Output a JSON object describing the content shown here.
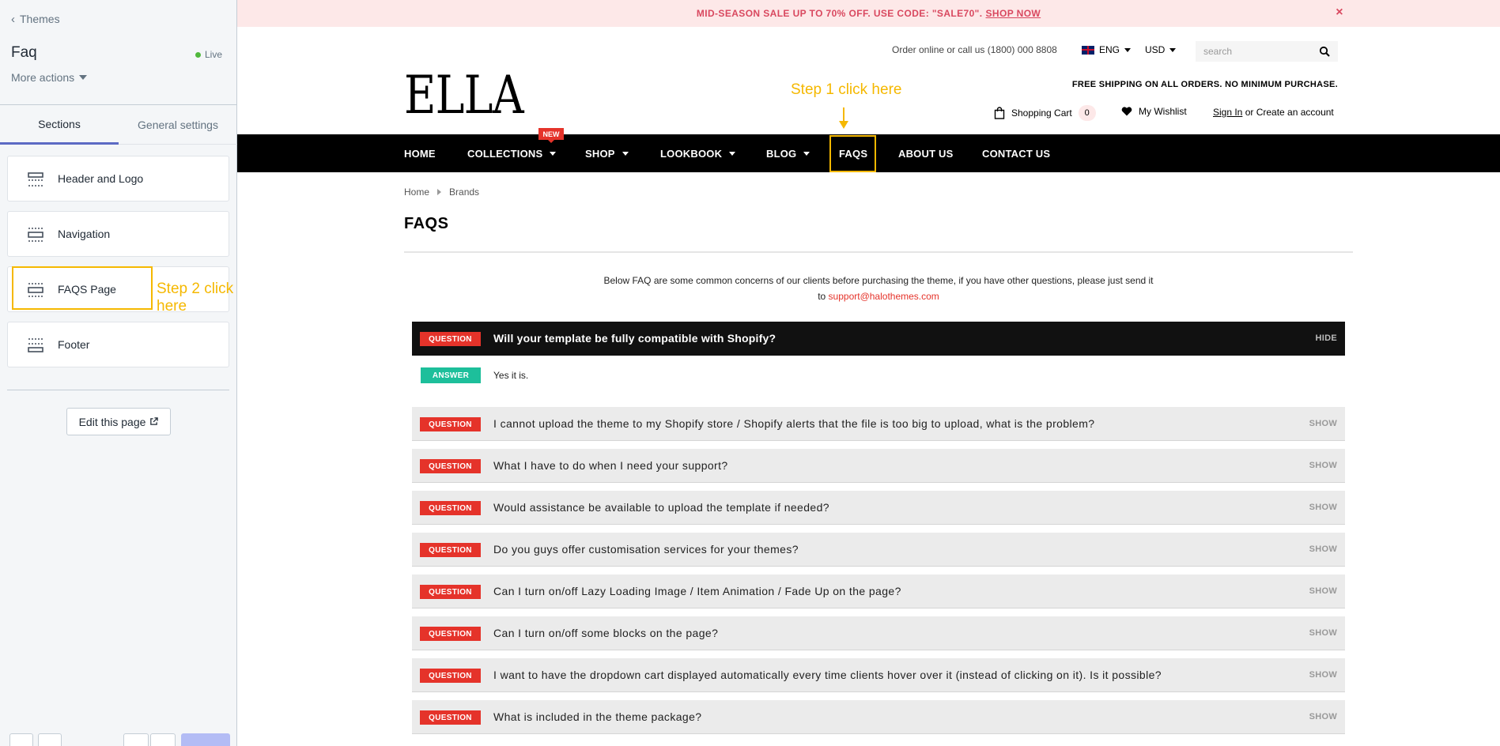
{
  "sidebar": {
    "back_label": "Themes",
    "page_title": "Faq",
    "status": "Live",
    "more_actions": "More actions",
    "tabs": [
      {
        "label": "Sections"
      },
      {
        "label": "General settings"
      }
    ],
    "sections": [
      {
        "label": "Header and Logo"
      },
      {
        "label": "Navigation"
      },
      {
        "label": "FAQS Page"
      },
      {
        "label": "Footer"
      }
    ],
    "step2_annotation": "Step 2 click here",
    "edit_button": "Edit this page"
  },
  "store": {
    "promo": {
      "text": "MID-SEASON SALE UP TO 70% OFF. USE CODE: \"SALE70\".",
      "link": "SHOP NOW",
      "close": "×"
    },
    "contact_line": "Order online or call us (1800) 000 8808",
    "language": "ENG",
    "currency": "USD",
    "search_placeholder": "search",
    "logo": "ELLA",
    "free_shipping": "FREE SHIPPING ON ALL ORDERS. NO MINIMUM PURCHASE.",
    "step1_annotation": "Step 1 click here",
    "cart_label": "Shopping Cart",
    "cart_count": "0",
    "wishlist_label": "My Wishlist",
    "sign_in": "Sign In",
    "or_create": " or Create an account",
    "nav": [
      {
        "label": "HOME"
      },
      {
        "label": "COLLECTIONS",
        "badge": "NEW"
      },
      {
        "label": "SHOP"
      },
      {
        "label": "LOOKBOOK"
      },
      {
        "label": "BLOG"
      },
      {
        "label": "FAQS"
      },
      {
        "label": "ABOUT US"
      },
      {
        "label": "CONTACT US"
      }
    ],
    "breadcrumb": {
      "home": "Home",
      "current": "Brands"
    },
    "page_heading": "FAQS",
    "intro_line1": "Below FAQ are some common concerns of our clients before purchasing the theme, if you have other questions, please just send it",
    "intro_to": "to ",
    "intro_email": "support@halothemes.com",
    "question_badge": "QUESTION",
    "answer_badge": "ANSWER",
    "faqs": [
      {
        "question": "Will your template be fully compatible with Shopify?",
        "toggle": "HIDE",
        "answer": "Yes it is."
      },
      {
        "question": "I cannot upload the theme to my Shopify store / Shopify alerts that the file is too big to upload, what is the problem?",
        "toggle": "SHOW"
      },
      {
        "question": "What I have to do when I need your support?",
        "toggle": "SHOW"
      },
      {
        "question": "Would assistance be available to upload the template if needed?",
        "toggle": "SHOW"
      },
      {
        "question": "Do you guys offer customisation services for your themes?",
        "toggle": "SHOW"
      },
      {
        "question": "Can I turn on/off Lazy Loading Image / Item Animation / Fade Up on the page?",
        "toggle": "SHOW"
      },
      {
        "question": "Can I turn on/off some blocks on the page?",
        "toggle": "SHOW"
      },
      {
        "question": "I want to have the dropdown cart displayed automatically every time clients hover over it (instead of clicking on it). Is it possible?",
        "toggle": "SHOW"
      },
      {
        "question": "What is included in the theme package?",
        "toggle": "SHOW"
      }
    ]
  },
  "colors": {
    "accent": "#5c6ac4",
    "annotation": "#f5b800",
    "brand_red": "#e5332a",
    "answer_green": "#1dbf9b",
    "promo_bg": "#fde8e8"
  }
}
